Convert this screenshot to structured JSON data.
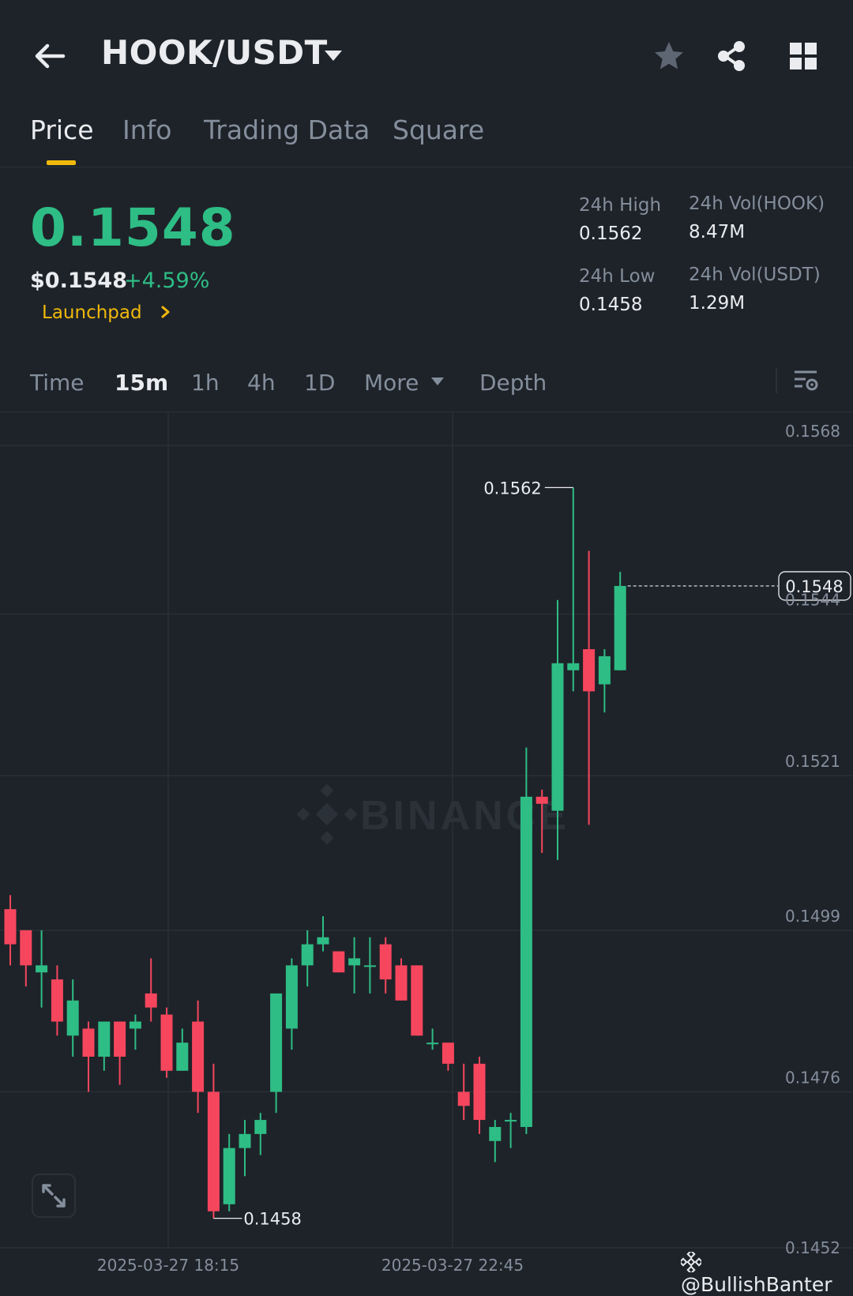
{
  "header": {
    "pair": "HOOK/USDT",
    "back_icon": "arrow-left-icon",
    "dropdown_icon": "caret-down-icon",
    "favorite_icon": "star-icon",
    "share_icon": "share-icon",
    "menu_icon": "grid-icon"
  },
  "tabs": [
    {
      "label": "Price",
      "active": true
    },
    {
      "label": "Info",
      "active": false
    },
    {
      "label": "Trading Data",
      "active": false
    },
    {
      "label": "Square",
      "active": false
    }
  ],
  "ticker": {
    "price": "0.1548",
    "fiat_price": "$0.1548",
    "change": "+4.59%",
    "launchpad": "Launchpad",
    "high_label": "24h High",
    "high_value": "0.1562",
    "low_label": "24h Low",
    "low_value": "0.1458",
    "vol_base_label": "24h Vol(HOOK)",
    "vol_base_value": "8.47M",
    "vol_quote_label": "24h Vol(USDT)",
    "vol_quote_value": "1.29M"
  },
  "intervals": {
    "items": [
      {
        "label": "Time",
        "active": false
      },
      {
        "label": "15m",
        "active": true
      },
      {
        "label": "1h",
        "active": false
      },
      {
        "label": "4h",
        "active": false
      },
      {
        "label": "1D",
        "active": false
      },
      {
        "label": "More",
        "active": false
      }
    ],
    "depth": "Depth",
    "settings_icon": "chart-settings-icon"
  },
  "chart_data": {
    "type": "candlestick",
    "interval": "15m",
    "y_ticks": [
      "0.1568",
      "0.1544",
      "0.1521",
      "0.1499",
      "0.1476",
      "0.1452"
    ],
    "x_ticks": [
      "2025-03-27 18:15",
      "2025-03-27 22:45"
    ],
    "ylim": [
      0.1452,
      0.1568
    ],
    "high_marker": "0.1562",
    "low_marker": "0.1458",
    "last_price": "0.1548",
    "watermark": "BINANCE",
    "up_color": "#2ebd85",
    "down_color": "#f6465d",
    "candles": [
      {
        "o": 0.1502,
        "h": 0.1504,
        "l": 0.1494,
        "c": 0.1497
      },
      {
        "o": 0.1499,
        "h": 0.1499,
        "l": 0.1491,
        "c": 0.1494
      },
      {
        "o": 0.1493,
        "h": 0.1499,
        "l": 0.1488,
        "c": 0.1494
      },
      {
        "o": 0.1492,
        "h": 0.1494,
        "l": 0.1484,
        "c": 0.1486
      },
      {
        "o": 0.1484,
        "h": 0.1492,
        "l": 0.1481,
        "c": 0.1489
      },
      {
        "o": 0.1485,
        "h": 0.1486,
        "l": 0.1476,
        "c": 0.1481
      },
      {
        "o": 0.1481,
        "h": 0.1486,
        "l": 0.1479,
        "c": 0.1486
      },
      {
        "o": 0.1486,
        "h": 0.1486,
        "l": 0.1477,
        "c": 0.1481
      },
      {
        "o": 0.1485,
        "h": 0.1487,
        "l": 0.1482,
        "c": 0.1486
      },
      {
        "o": 0.149,
        "h": 0.1495,
        "l": 0.1486,
        "c": 0.1488
      },
      {
        "o": 0.1487,
        "h": 0.1488,
        "l": 0.1478,
        "c": 0.1479
      },
      {
        "o": 0.1479,
        "h": 0.1485,
        "l": 0.1479,
        "c": 0.1483
      },
      {
        "o": 0.1486,
        "h": 0.1489,
        "l": 0.1473,
        "c": 0.1476
      },
      {
        "o": 0.1476,
        "h": 0.148,
        "l": 0.1458,
        "c": 0.1459
      },
      {
        "o": 0.146,
        "h": 0.147,
        "l": 0.1459,
        "c": 0.1468
      },
      {
        "o": 0.1468,
        "h": 0.1472,
        "l": 0.1464,
        "c": 0.147
      },
      {
        "o": 0.147,
        "h": 0.1473,
        "l": 0.1467,
        "c": 0.1472
      },
      {
        "o": 0.1476,
        "h": 0.149,
        "l": 0.1473,
        "c": 0.149
      },
      {
        "o": 0.1485,
        "h": 0.1495,
        "l": 0.1482,
        "c": 0.1494
      },
      {
        "o": 0.1494,
        "h": 0.1499,
        "l": 0.1491,
        "c": 0.1497
      },
      {
        "o": 0.1497,
        "h": 0.1501,
        "l": 0.1496,
        "c": 0.1498
      },
      {
        "o": 0.1496,
        "h": 0.1496,
        "l": 0.1493,
        "c": 0.1493
      },
      {
        "o": 0.1494,
        "h": 0.1498,
        "l": 0.149,
        "c": 0.1495
      },
      {
        "o": 0.1494,
        "h": 0.1498,
        "l": 0.149,
        "c": 0.1494
      },
      {
        "o": 0.1497,
        "h": 0.1498,
        "l": 0.149,
        "c": 0.1492
      },
      {
        "o": 0.1494,
        "h": 0.1495,
        "l": 0.1489,
        "c": 0.1489
      },
      {
        "o": 0.1494,
        "h": 0.1494,
        "l": 0.1484,
        "c": 0.1484
      },
      {
        "o": 0.1483,
        "h": 0.1485,
        "l": 0.1482,
        "c": 0.1483
      },
      {
        "o": 0.1483,
        "h": 0.1483,
        "l": 0.1479,
        "c": 0.148
      },
      {
        "o": 0.1476,
        "h": 0.148,
        "l": 0.1472,
        "c": 0.1474
      },
      {
        "o": 0.148,
        "h": 0.1481,
        "l": 0.147,
        "c": 0.1472
      },
      {
        "o": 0.1469,
        "h": 0.1472,
        "l": 0.1466,
        "c": 0.1471
      },
      {
        "o": 0.1472,
        "h": 0.1473,
        "l": 0.1468,
        "c": 0.1472
      },
      {
        "o": 0.1471,
        "h": 0.1525,
        "l": 0.147,
        "c": 0.1518
      },
      {
        "o": 0.1518,
        "h": 0.1519,
        "l": 0.151,
        "c": 0.1517
      },
      {
        "o": 0.1516,
        "h": 0.1546,
        "l": 0.1509,
        "c": 0.1537
      },
      {
        "o": 0.1536,
        "h": 0.1562,
        "l": 0.1533,
        "c": 0.1537
      },
      {
        "o": 0.1539,
        "h": 0.1553,
        "l": 0.1514,
        "c": 0.1533
      },
      {
        "o": 0.1534,
        "h": 0.1539,
        "l": 0.153,
        "c": 0.1538
      },
      {
        "o": 0.1536,
        "h": 0.155,
        "l": 0.1536,
        "c": 0.1548
      }
    ]
  },
  "chart_controls": {
    "expand_icon": "expand-icon"
  },
  "watermark_user": "@BullishBanter"
}
